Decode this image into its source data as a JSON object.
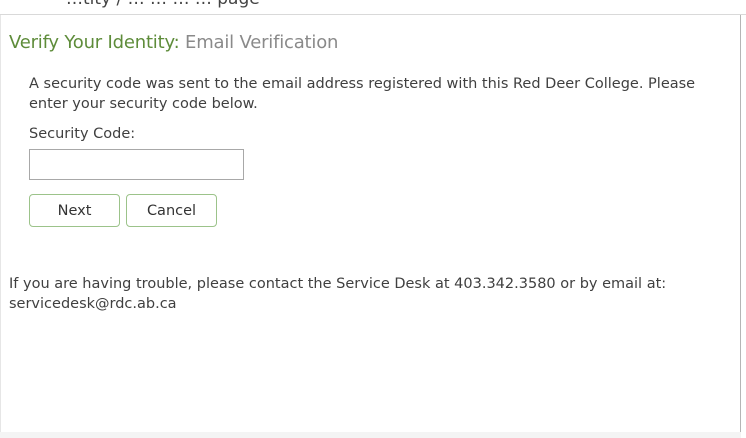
{
  "header_fragment": {
    "text": "…tity / … … … … page"
  },
  "verify": {
    "title": "Verify Your Identity:",
    "subtitle": "Email Verification",
    "message": "A security code was sent to the email address registered with this Red Deer College. Please enter your security code below.",
    "security_code_label": "Security Code:",
    "security_code_value": "",
    "next_label": "Next",
    "cancel_label": "Cancel"
  },
  "help": {
    "text": "If you are having trouble, please contact the Service Desk at 403.342.3580 or by email at: servicedesk@rdc.ab.ca"
  },
  "colors": {
    "title": "#5e8c3a",
    "subtitle": "#8a8a8a",
    "button_border": "#9cc38a"
  }
}
